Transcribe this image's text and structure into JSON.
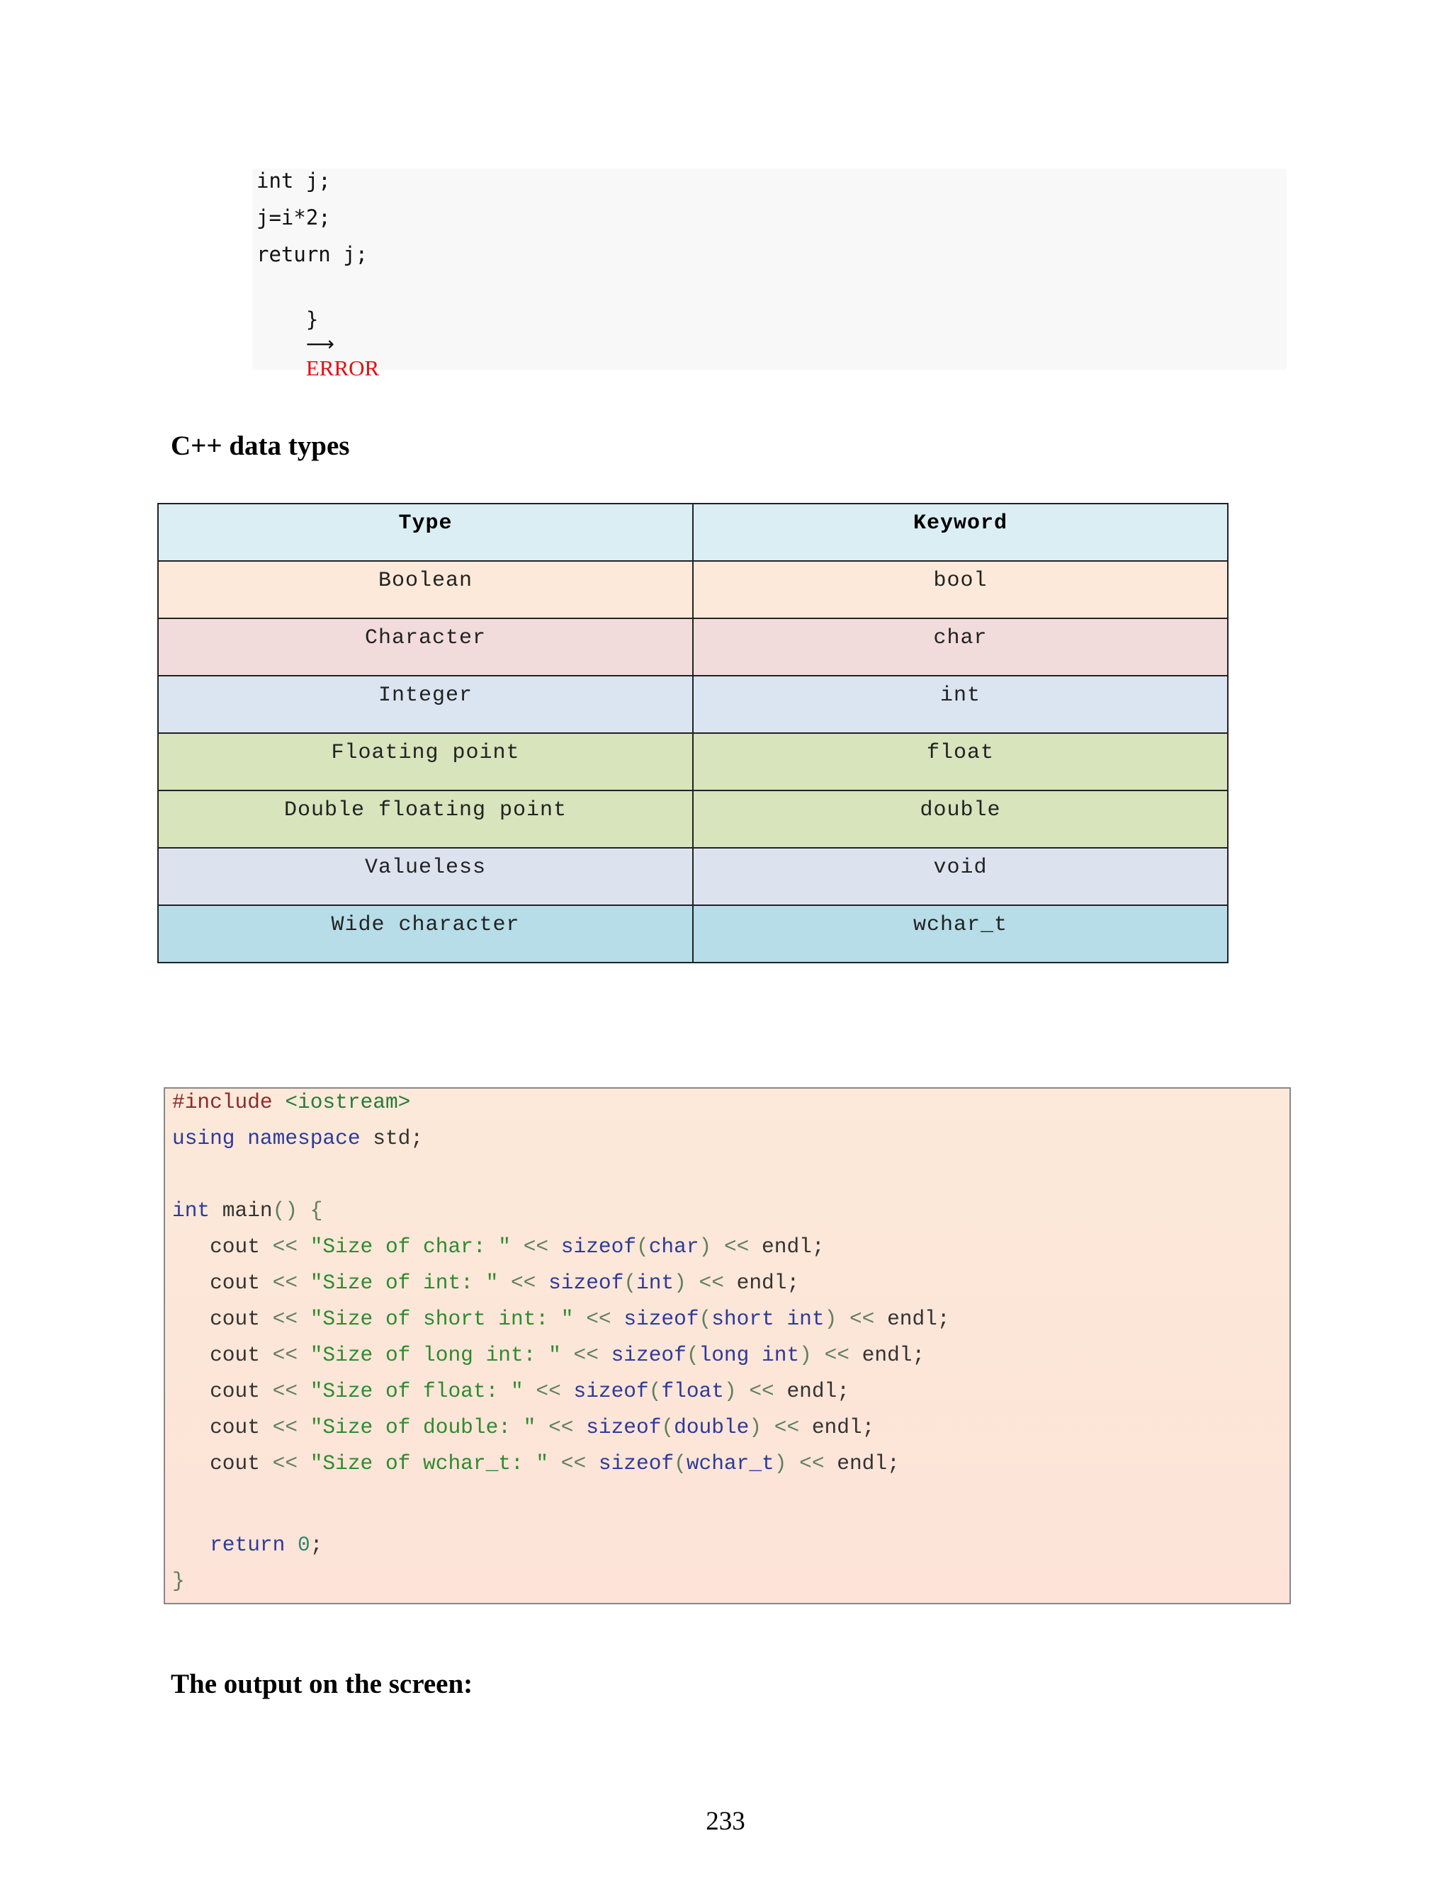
{
  "snippet_top": {
    "lines": [
      "int j;",
      "j=i*2;",
      "return j;"
    ],
    "last_line_code": "}",
    "arrow": "⟶",
    "error_label": "ERROR"
  },
  "heading_types": "C++ data types",
  "types_table": {
    "headers": [
      "Type",
      "Keyword"
    ],
    "rows": [
      {
        "type": "Boolean",
        "keyword": "bool",
        "bg": "#fde9d9"
      },
      {
        "type": "Character",
        "keyword": "char",
        "bg": "#f2dcdb"
      },
      {
        "type": "Integer",
        "keyword": "int",
        "bg": "#dbe5f1"
      },
      {
        "type": "Floating point",
        "keyword": "float",
        "bg": "#d7e4bc"
      },
      {
        "type": "Double floating point",
        "keyword": "double",
        "bg": "#d7e4bc"
      },
      {
        "type": "Valueless",
        "keyword": "void",
        "bg": "#dde3ee"
      },
      {
        "type": "Wide character",
        "keyword": "wchar_t",
        "bg": "#b6dde8"
      }
    ],
    "header_bg": "#dbeef3"
  },
  "code_block": {
    "include_directive": "#include",
    "include_header": "<iostream>",
    "using_kw": "using namespace",
    "using_rest": " std;",
    "main_kw": "int",
    "main_name": " main",
    "main_parens": "()",
    "open_brace": "{",
    "cout_word": "cout",
    "shift_op": "<<",
    "sizeof_kw": "sizeof",
    "endl_word": "endl;",
    "cout_lines": [
      {
        "label": "\"Size of char: \"",
        "arg": "char"
      },
      {
        "label": "\"Size of int: \"",
        "arg": "int"
      },
      {
        "label": "\"Size of short int: \"",
        "arg": "short int"
      },
      {
        "label": "\"Size of long int: \"",
        "arg": "long int"
      },
      {
        "label": "\"Size of float: \"",
        "arg": "float"
      },
      {
        "label": "\"Size of double: \"",
        "arg": "double"
      },
      {
        "label": "\"Size of wchar_t: \"",
        "arg": "wchar_t"
      }
    ],
    "return_kw": "return",
    "return_value": "0",
    "close_brace": "}"
  },
  "heading_output": "The output on the screen:",
  "page_number": "233"
}
